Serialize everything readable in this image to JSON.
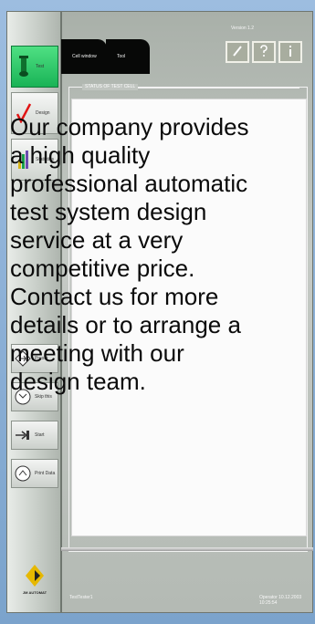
{
  "sidebar": {
    "top_buttons": [
      {
        "label": "Test",
        "icon": "test-tube-icon"
      },
      {
        "label": "Design",
        "icon": "checkmark-icon"
      },
      {
        "label": "Statistics",
        "icon": "bar-graph-icon"
      }
    ],
    "bottom_buttons": [
      {
        "label": "Preset",
        "icon": "diamond-arrow-icon"
      },
      {
        "label": "Skip this",
        "icon": "skip-icon"
      },
      {
        "label": "Start",
        "icon": "start-arrow-icon"
      },
      {
        "label": "Print Data",
        "icon": "print-icon"
      }
    ],
    "logo_text": "JM AUTOMAT"
  },
  "header": {
    "tabs": [
      "Cell window",
      "Tool"
    ],
    "version": "Version 1.2"
  },
  "panel": {
    "group_title": "STATUS OF TEST CELL",
    "message": "Our company provides a high quality professional automatic test system design service at a very competitive price. Contact us for more details or to arrange a meeting with our design team."
  },
  "status_bar": {
    "left": "TestTester1",
    "right": "Operator 10.12.2003 10:25:54"
  },
  "colors": {
    "active_button": "#19b356",
    "tab_bg": "#070807",
    "background": "#8fb3d6"
  }
}
